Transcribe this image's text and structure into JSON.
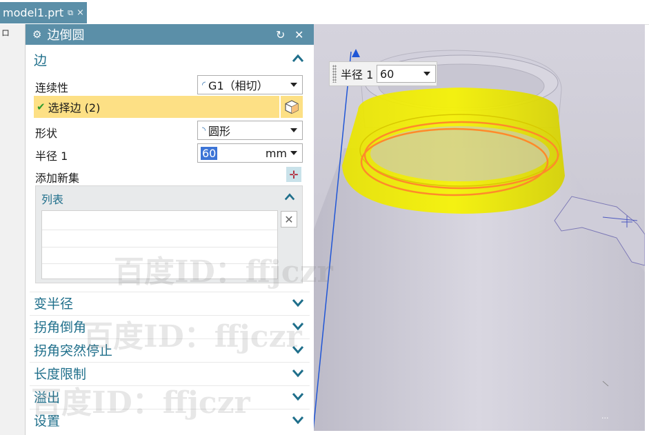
{
  "tab": {
    "filename": "model1.prt",
    "tab_icon": "restore-icon",
    "close": "×"
  },
  "left_strip_glyph": "ロ",
  "dialog": {
    "title": "边倒圆",
    "reset_icon": "↻",
    "close_icon": "✕",
    "edge_group": {
      "header": "边",
      "continuity_label": "连续性",
      "continuity_value": "G1（相切）",
      "select_edge_label": "选择边 (2)",
      "shape_label": "形状",
      "shape_value": "圆形",
      "radius_label": "半径 1",
      "radius_value": "60",
      "radius_unit": "mm",
      "add_new_set_label": "添加新集",
      "list_title": "列表"
    },
    "collapsed_groups": [
      "变半径",
      "拐角倒角",
      "拐角突然停止",
      "长度限制",
      "溢出",
      "设置"
    ]
  },
  "viewport": {
    "radius_popup_label": "半径 1",
    "radius_popup_value": "60",
    "corner_dots": "..."
  },
  "watermark": "百度ID：ffjczr",
  "colors": {
    "title_bar": "#5b8fa8",
    "group_text": "#1f6f8b",
    "selection_highlight": "#fde085",
    "fillet_yellow": "#f4f100",
    "edge_orange": "#ff8a2a",
    "axis_blue": "#1f55d6"
  }
}
